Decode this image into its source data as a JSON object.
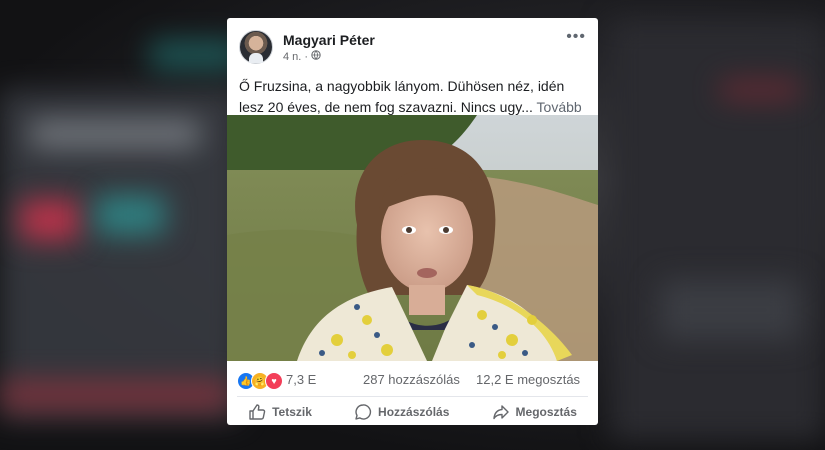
{
  "post": {
    "author": "Magyari Péter",
    "time": "4 n.",
    "audience_icon": "globe-icon",
    "text": "Ő Fruzsina, a nagyobbik lányom. Dühösen néz, idén lesz 20 éves, de nem fog szavazni. Nincs ugy...",
    "more_link": "Tovább"
  },
  "stats": {
    "reactions": [
      "like",
      "care",
      "love"
    ],
    "reaction_count": "7,3 E",
    "comments": "287 hozzászólás",
    "shares": "12,2 E megosztás"
  },
  "actions": {
    "like": "Tetszik",
    "comment": "Hozzászólás",
    "share": "Megosztás"
  },
  "colors": {
    "like_blue": "#1877f2",
    "love_red": "#f33e58",
    "care_yellow": "#f7b125",
    "text_gray": "#65676b"
  }
}
